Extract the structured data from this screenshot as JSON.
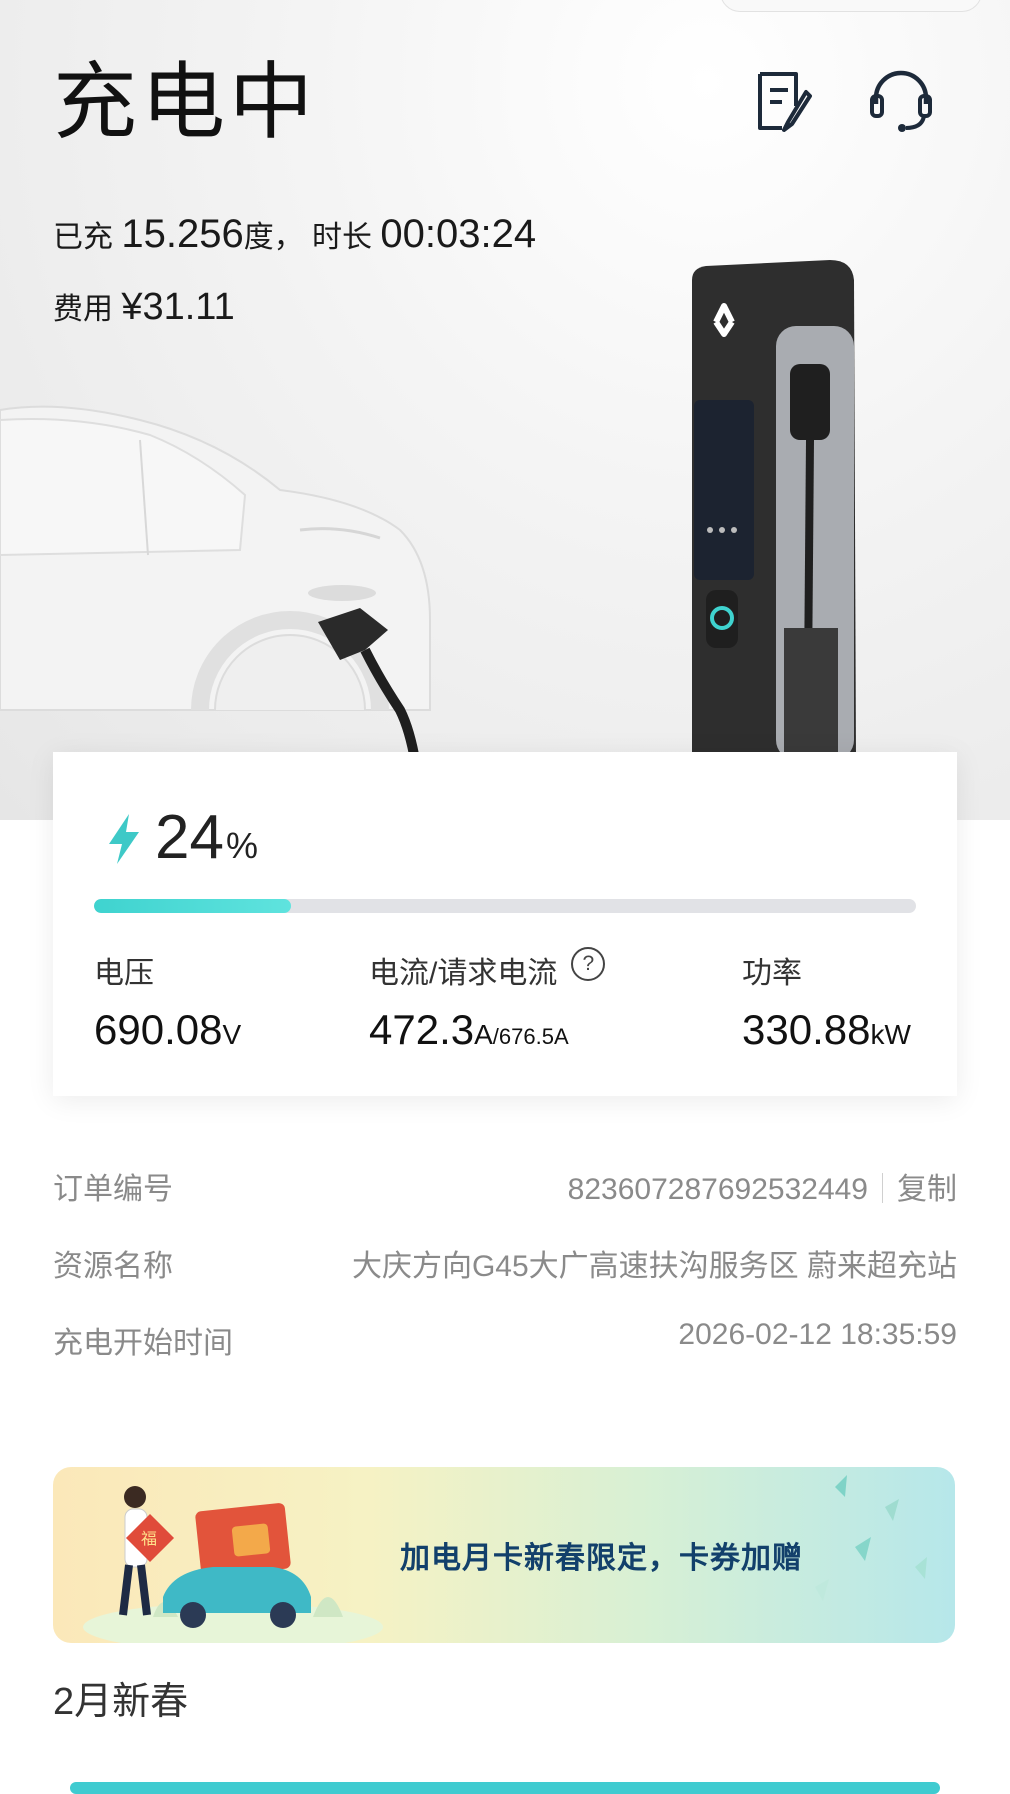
{
  "header": {
    "title": "充电中",
    "charged_prefix": "已充",
    "charged_value": "15.256",
    "charged_unit": "度，",
    "duration_label": "时长",
    "duration_value": "00:03:24",
    "fee_label": "费用",
    "fee_value": "¥31.11"
  },
  "icons": {
    "order_note": "edit-document-icon",
    "support": "headset-icon",
    "bolt": "lightning-bolt-icon",
    "help": "question-circle-icon"
  },
  "battery": {
    "percent_value": "24",
    "percent_unit": "%",
    "progress_fraction": 0.24
  },
  "metrics": {
    "voltage": {
      "label": "电压",
      "value": "690.08",
      "unit": "V"
    },
    "current": {
      "label": "电流/请求电流",
      "value": "472.3",
      "unit": "A",
      "requested": "/676.5A",
      "help": "?"
    },
    "power": {
      "label": "功率",
      "value": "330.88",
      "unit": "kW"
    }
  },
  "order": {
    "number_label": "订单编号",
    "number_value": "823607287692532449",
    "copy_label": "复制",
    "resource_label": "资源名称",
    "resource_value": "大庆方向G45大广高速扶沟服务区 蔚来超充站",
    "start_label": "充电开始时间",
    "start_value": "2026-02-12 18:35:59"
  },
  "banner": {
    "text": "加电月卡新春限定，卡券加赠",
    "badge": "福"
  },
  "section": {
    "title": "2月新春"
  },
  "colors": {
    "accent": "#3fd3cf",
    "track": "#e1e2e6",
    "banner_text": "#12406b"
  }
}
